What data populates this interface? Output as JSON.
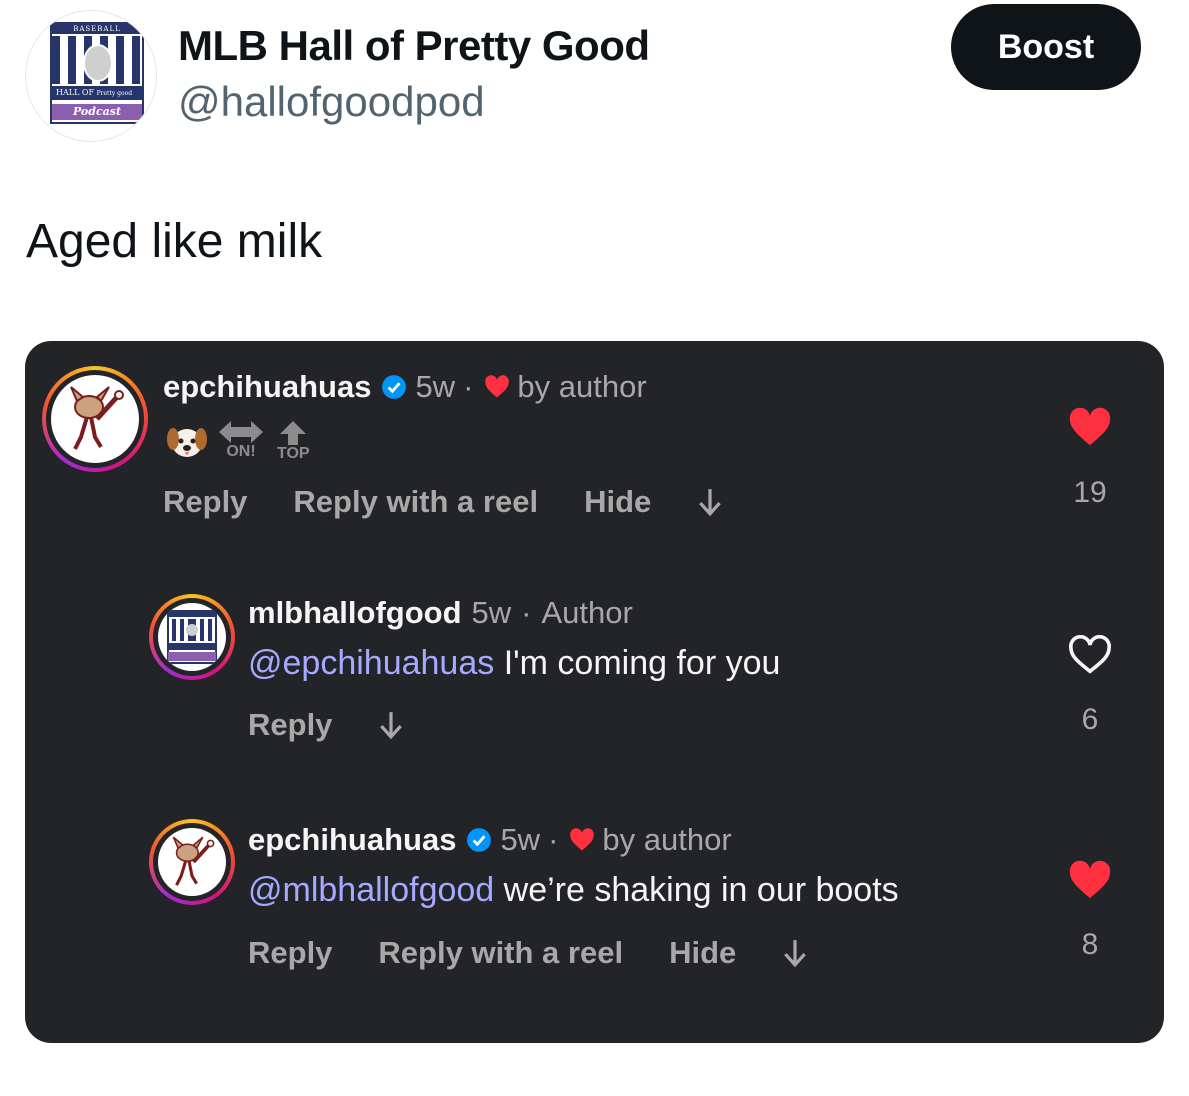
{
  "header": {
    "display_name": "MLB Hall of Pretty Good",
    "handle": "@hallofgoodpod",
    "boost_label": "Boost",
    "avatar_logo": {
      "top": "BASEBALL",
      "hall": "HALL OF",
      "pretty_good": "Pretty good",
      "podcast": "Podcast"
    }
  },
  "tweet": {
    "text": "Aged like milk"
  },
  "embedded_screenshot": {
    "comments": [
      {
        "username": "epchihuahuas",
        "time": "5w",
        "separator": "·",
        "liked_by": "by author",
        "emoji_text": {
          "left": "ON!",
          "right": "TOP"
        },
        "actions": [
          "Reply",
          "Reply with a reel",
          "Hide"
        ],
        "like_count": "19",
        "liked": true
      },
      {
        "username": "mlbhallofgood",
        "time": "5w",
        "separator": "·",
        "role": "Author",
        "mention": "@epchihuahuas",
        "text": " I'm coming for you",
        "actions": [
          "Reply"
        ],
        "like_count": "6",
        "liked": false
      },
      {
        "username": "epchihuahuas",
        "time": "5w",
        "separator": "·",
        "liked_by": "by author",
        "mention": "@mlbhallofgood",
        "text": " we’re shaking in our boots",
        "actions": [
          "Reply",
          "Reply with a reel",
          "Hide"
        ],
        "like_count": "8",
        "liked": true
      }
    ]
  },
  "colors": {
    "card_bg": "#222428",
    "mention": "#a6a9ff",
    "heart_red": "#ff3040",
    "verified_blue": "#0095f6",
    "boost_bg": "#0f1419"
  }
}
